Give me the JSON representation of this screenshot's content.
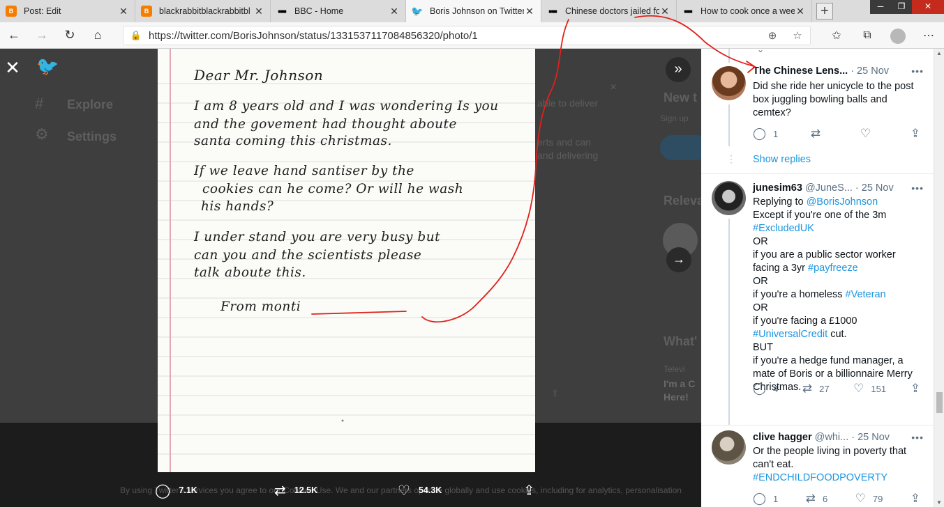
{
  "browser": {
    "tabs": [
      {
        "title": "Post: Edit",
        "favicon": "blogger-icon"
      },
      {
        "title": "blackrabbitblackrabbitbl",
        "favicon": "blogger-icon"
      },
      {
        "title": "BBC - Home",
        "favicon": "bbc-icon"
      },
      {
        "title": "Boris Johnson on Twitter",
        "favicon": "twitter-icon"
      },
      {
        "title": "Chinese doctors jailed fo",
        "favicon": "bbc-icon"
      },
      {
        "title": "How to cook once a wee",
        "favicon": "bbc-icon"
      }
    ],
    "url": "https://twitter.com/BorisJohnson/status/1331537117084856320/photo/1"
  },
  "background": {
    "nav_explore": "Explore",
    "nav_settings": "Settings",
    "snippet1": "able to deliver",
    "snippet2": "erts and can",
    "snippet3": "and delivering",
    "new_to": "New t",
    "sign_up": "Sign up",
    "relevant": "Releva",
    "whats": "What'",
    "televi": "Televi",
    "ima": "I'm a C",
    "here": "Here!",
    "footer": "By using Twitter's services you agree to our Cookies Use. We and our partners operate globally and use cookies, including for analytics, personalisation"
  },
  "letter": {
    "lines": [
      "Dear Mr. Johnson",
      "I am 8 years old and I was wondering Is you",
      "and the govement had thought aboute",
      "santa coming this christmas.",
      "If we leave hand santiser by the",
      "cookies can he come? Or will he wash",
      "his hands?",
      "I under stand you are very busy but",
      "can you and the scientists please",
      "talk aboute this.",
      "From monti"
    ]
  },
  "stats": {
    "replies": "7.1K",
    "retweets": "12.5K",
    "likes": "54.3K"
  },
  "replies": [
    {
      "name": "The Chinese Lens...",
      "date": "· 25 Nov",
      "text": "Did she ride her unicycle to the post box juggling bowling balls and cemtex?",
      "reply_count": "1",
      "retweet_count": "",
      "like_count": "",
      "show_replies": "Show replies"
    },
    {
      "name": "junesim63",
      "handle": "@JuneS...",
      "date": "· 25 Nov",
      "replying_to_label": "Replying to",
      "replying_to": "@BorisJohnson",
      "lines": [
        {
          "t": "Except if you're one of the 3m",
          "link": false
        },
        {
          "t": "#ExcludedUK",
          "link": true
        },
        {
          "t": "OR",
          "link": false
        },
        {
          "t": "if you are a public sector worker",
          "link": false
        },
        {
          "t": "facing a 3yr ",
          "link": false,
          "tag": "#payfreeze"
        },
        {
          "t": "OR",
          "link": false
        },
        {
          "t": "if you're a homeless ",
          "link": false,
          "tag": "#Veteran"
        },
        {
          "t": "OR",
          "link": false
        },
        {
          "t": "if you're facing a £1000",
          "link": false
        },
        {
          "t": "#UniversalCredit",
          "link": true,
          "after": " cut."
        },
        {
          "t": "BUT",
          "link": false
        },
        {
          "t": "if you're a hedge fund manager, a",
          "link": false
        },
        {
          "t": "mate of Boris or a billionnaire Merry",
          "link": false
        },
        {
          "t": "Christmas.",
          "link": false
        }
      ],
      "reply_count": "4",
      "retweet_count": "27",
      "like_count": "151"
    },
    {
      "name": "clive hagger",
      "handle": "@whi...",
      "date": "· 25 Nov",
      "text1": "Or the people living in poverty that",
      "text2": "can't eat.",
      "tag": "#ENDCHILDFOODPOVERTY",
      "reply_count": "1",
      "retweet_count": "6",
      "like_count": "79"
    }
  ],
  "colors": {
    "twitter_blue": "#1b95e0",
    "annotation_red": "#e0211b"
  }
}
